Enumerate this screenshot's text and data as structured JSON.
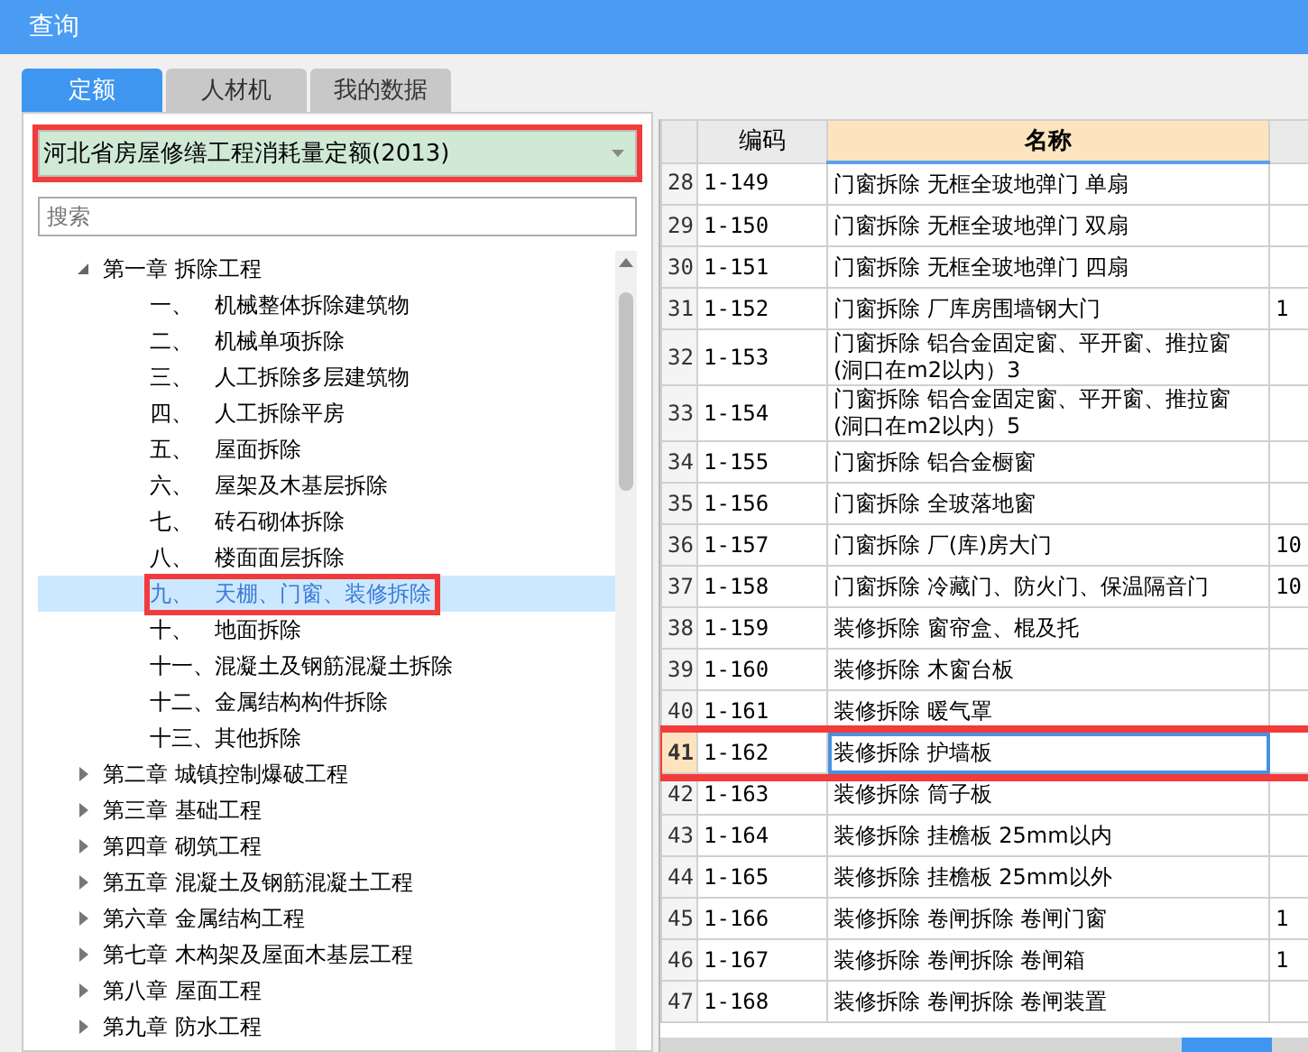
{
  "window": {
    "title": "查询"
  },
  "tabs": [
    {
      "label": "定额",
      "selected": true
    },
    {
      "label": "人材机",
      "selected": false
    },
    {
      "label": "我的数据",
      "selected": false
    }
  ],
  "quota_dropdown": {
    "value": "河北省房屋修缮工程消耗量定额(2013)",
    "marked": true
  },
  "search": {
    "placeholder": "搜索"
  },
  "tree": [
    {
      "label": "第一章 拆除工程",
      "expanded": true,
      "selected": false,
      "children": [
        {
          "number": "一、",
          "label": "机械整体拆除建筑物",
          "selected": false,
          "marked": false
        },
        {
          "number": "二、",
          "label": "机械单项拆除",
          "selected": false,
          "marked": false
        },
        {
          "number": "三、",
          "label": "人工拆除多层建筑物",
          "selected": false,
          "marked": false
        },
        {
          "number": "四、",
          "label": "人工拆除平房",
          "selected": false,
          "marked": false
        },
        {
          "number": "五、",
          "label": "屋面拆除",
          "selected": false,
          "marked": false
        },
        {
          "number": "六、",
          "label": "屋架及木基层拆除",
          "selected": false,
          "marked": false
        },
        {
          "number": "七、",
          "label": "砖石砌体拆除",
          "selected": false,
          "marked": false
        },
        {
          "number": "八、",
          "label": "楼面面层拆除",
          "selected": false,
          "marked": false
        },
        {
          "number": "九、",
          "label": "天棚、门窗、装修拆除",
          "selected": true,
          "marked": true
        },
        {
          "number": "十、",
          "label": "地面拆除",
          "selected": false,
          "marked": false
        },
        {
          "number": "十一、",
          "label": "混凝土及钢筋混凝土拆除",
          "selected": false,
          "marked": false
        },
        {
          "number": "十二、",
          "label": "金属结构构件拆除",
          "selected": false,
          "marked": false
        },
        {
          "number": "十三、",
          "label": "其他拆除",
          "selected": false,
          "marked": false
        }
      ]
    },
    {
      "label": "第二章 城镇控制爆破工程",
      "expanded": false,
      "selected": false
    },
    {
      "label": "第三章 基础工程",
      "expanded": false,
      "selected": false
    },
    {
      "label": "第四章 砌筑工程",
      "expanded": false,
      "selected": false
    },
    {
      "label": "第五章 混凝土及钢筋混凝土工程",
      "expanded": false,
      "selected": false
    },
    {
      "label": "第六章 金属结构工程",
      "expanded": false,
      "selected": false
    },
    {
      "label": "第七章 木构架及屋面木基层工程",
      "expanded": false,
      "selected": false
    },
    {
      "label": "第八章 屋面工程",
      "expanded": false,
      "selected": false
    },
    {
      "label": "第九章 防水工程",
      "expanded": false,
      "selected": false
    }
  ],
  "table": {
    "columns": [
      {
        "label": "编码",
        "selected": false
      },
      {
        "label": "名称",
        "selected": true
      }
    ],
    "rows": [
      {
        "index": "28",
        "code": "1-149",
        "name": "门窗拆除 无框全玻地弹门 单扇",
        "column_3": "",
        "selected": false,
        "marked": false
      },
      {
        "index": "29",
        "code": "1-150",
        "name": "门窗拆除 无框全玻地弹门 双扇",
        "column_3": "",
        "selected": false,
        "marked": false
      },
      {
        "index": "30",
        "code": "1-151",
        "name": "门窗拆除 无框全玻地弹门 四扇",
        "column_3": "",
        "selected": false,
        "marked": false
      },
      {
        "index": "31",
        "code": "1-152",
        "name": "门窗拆除 厂库房围墙钢大门",
        "column_3": "1",
        "selected": false,
        "marked": false
      },
      {
        "index": "32",
        "code": "1-153",
        "name": "门窗拆除 铝合金固定窗、平开窗、推拉窗\n(洞口在m2以内）3",
        "column_3": "",
        "selected": false,
        "marked": false
      },
      {
        "index": "33",
        "code": "1-154",
        "name": "门窗拆除 铝合金固定窗、平开窗、推拉窗\n(洞口在m2以内）5",
        "column_3": "",
        "selected": false,
        "marked": false
      },
      {
        "index": "34",
        "code": "1-155",
        "name": "门窗拆除 铝合金橱窗",
        "column_3": "",
        "selected": false,
        "marked": false
      },
      {
        "index": "35",
        "code": "1-156",
        "name": "门窗拆除 全玻落地窗",
        "column_3": "",
        "selected": false,
        "marked": false
      },
      {
        "index": "36",
        "code": "1-157",
        "name": "门窗拆除 厂(库)房大门",
        "column_3": "10",
        "selected": false,
        "marked": false
      },
      {
        "index": "37",
        "code": "1-158",
        "name": "门窗拆除 冷藏门、防火门、保温隔音门",
        "column_3": "10",
        "selected": false,
        "marked": false
      },
      {
        "index": "38",
        "code": "1-159",
        "name": "装修拆除 窗帘盒、棍及托",
        "column_3": "",
        "selected": false,
        "marked": false
      },
      {
        "index": "39",
        "code": "1-160",
        "name": "装修拆除 木窗台板",
        "column_3": "",
        "selected": false,
        "marked": false
      },
      {
        "index": "40",
        "code": "1-161",
        "name": "装修拆除 暖气罩",
        "column_3": "",
        "selected": false,
        "marked": false
      },
      {
        "index": "41",
        "code": "1-162",
        "name": "装修拆除 护墙板",
        "column_3": "",
        "selected": true,
        "marked": true
      },
      {
        "index": "42",
        "code": "1-163",
        "name": "装修拆除 筒子板",
        "column_3": "",
        "selected": false,
        "marked": false
      },
      {
        "index": "43",
        "code": "1-164",
        "name": "装修拆除 挂檐板 25mm以内",
        "column_3": "",
        "selected": false,
        "marked": false
      },
      {
        "index": "44",
        "code": "1-165",
        "name": "装修拆除 挂檐板 25mm以外",
        "column_3": "",
        "selected": false,
        "marked": false
      },
      {
        "index": "45",
        "code": "1-166",
        "name": "装修拆除 卷闸拆除 卷闸门窗",
        "column_3": "1",
        "selected": false,
        "marked": false
      },
      {
        "index": "46",
        "code": "1-167",
        "name": "装修拆除 卷闸拆除 卷闸箱",
        "column_3": "1",
        "selected": false,
        "marked": false
      },
      {
        "index": "47",
        "code": "1-168",
        "name": "装修拆除 卷闸拆除 卷闸装置",
        "column_3": "",
        "selected": false,
        "marked": false
      }
    ]
  }
}
